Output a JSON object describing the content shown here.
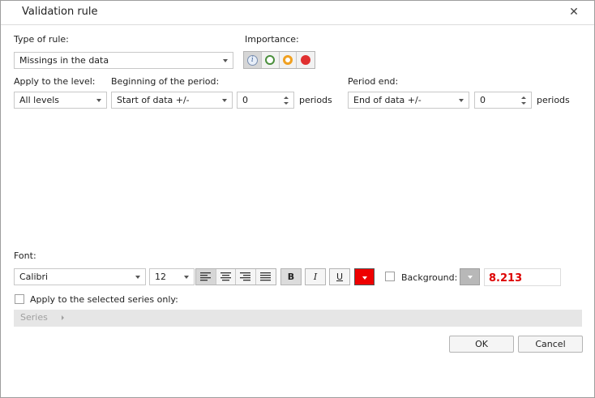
{
  "dialog": {
    "title": "Validation rule",
    "close_icon": "close-icon"
  },
  "rule_type": {
    "label": "Type of rule:",
    "value": "Missings in the data"
  },
  "importance": {
    "label": "Importance:",
    "options": [
      {
        "name": "info",
        "color": "#7a8fb0",
        "selected": true,
        "glyph": "i"
      },
      {
        "name": "green",
        "color": "#4a8f3c"
      },
      {
        "name": "orange",
        "color": "#f0a020"
      },
      {
        "name": "red",
        "color": "#e03030"
      }
    ]
  },
  "apply_level": {
    "label": "Apply to the level:",
    "value": "All levels"
  },
  "period_begin": {
    "label": "Beginning of the period:",
    "value": "Start of data +/-",
    "offset": "0",
    "unit": "periods"
  },
  "period_end": {
    "label": "Period end:",
    "value": "End of data +/-",
    "offset": "0",
    "unit": "periods"
  },
  "font": {
    "label": "Font:",
    "family": "Calibri",
    "size": "12",
    "alignment_selected": "left",
    "bold_label": "B",
    "italic_label": "I",
    "underline_label": "U",
    "font_color": "#ee0000",
    "background_label": "Background:",
    "background_checked": false,
    "preview_text": "8.213",
    "preview_color": "#dd0000"
  },
  "selected_series": {
    "label": "Apply to the selected series only:",
    "checked": false,
    "series_label": "Series"
  },
  "buttons": {
    "ok": "OK",
    "cancel": "Cancel"
  }
}
